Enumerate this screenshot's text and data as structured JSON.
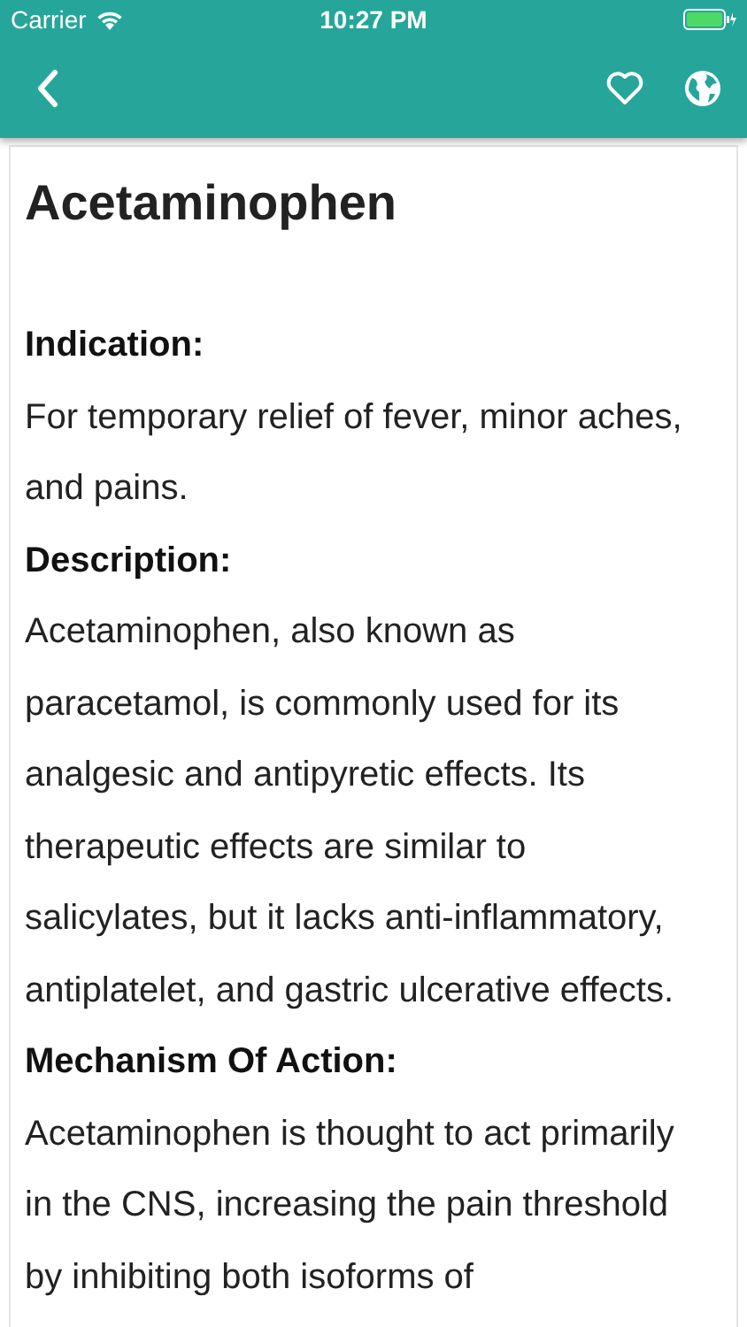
{
  "status_bar": {
    "carrier": "Carrier",
    "time": "10:27 PM"
  },
  "drug": {
    "title": "Acetaminophen",
    "sections": [
      {
        "heading": "Indication:",
        "text": "For temporary relief of fever, minor aches, and pains."
      },
      {
        "heading": "Description:",
        "text": "Acetaminophen, also known as paracetamol, is commonly used for its analgesic and antipyretic effects. Its therapeutic effects are similar to salicylates, but it lacks anti-inflammatory, antiplatelet, and gastric ulcerative effects."
      },
      {
        "heading": "Mechanism Of Action:",
        "text": "Acetaminophen is thought to act primarily in the CNS, increasing the pain threshold by inhibiting both isoforms of"
      }
    ]
  }
}
